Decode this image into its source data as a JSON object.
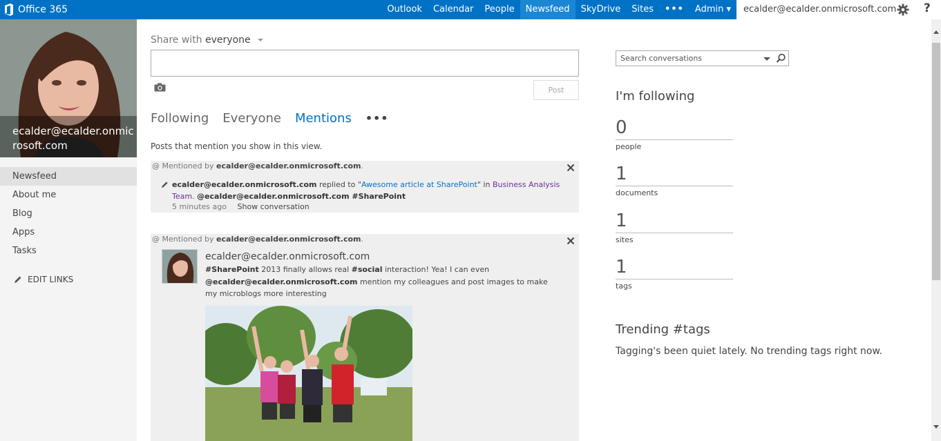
{
  "topbar": {
    "brand": "Office 365",
    "nav": [
      {
        "label": "Outlook"
      },
      {
        "label": "Calendar"
      },
      {
        "label": "People"
      },
      {
        "label": "Newsfeed",
        "active": true
      },
      {
        "label": "SkyDrive"
      },
      {
        "label": "Sites"
      },
      {
        "label": "•••"
      },
      {
        "label": "Admin ▾"
      }
    ],
    "user": "ecalder@ecalder.onmicrosoft.com ▾",
    "help": "?"
  },
  "profile": {
    "name": "ecalder@ecalder.onmicrosoft.com"
  },
  "quicklaunch": {
    "items": [
      "Newsfeed",
      "About me",
      "Blog",
      "Apps",
      "Tasks"
    ],
    "edit_links": "EDIT LINKS"
  },
  "composer": {
    "share_prefix": "Share with",
    "share_target": "everyone",
    "post_button": "Post"
  },
  "tabs": {
    "following": "Following",
    "everyone": "Everyone",
    "mentions": "Mentions",
    "more": "•••"
  },
  "hint": "Posts that mention you show in this view.",
  "feed": {
    "post1": {
      "mentioned_prefix": "Mentioned by",
      "mentioned_by": "ecalder@ecalder.onmicrosoft.com",
      "actor": "ecalder@ecalder.onmicrosoft.com",
      "replied_to": "replied to \"",
      "link": "Awesome article at SharePoint",
      "in": "\" in",
      "team": "Business Analysis Team",
      "mention": "@ecalder@ecalder.onmicrosoft.com #SharePoint",
      "time": "5 minutes ago",
      "show": "Show conversation"
    },
    "post2": {
      "mentioned_prefix": "Mentioned by",
      "mentioned_by": "ecalder@ecalder.onmicrosoft.com",
      "author": "ecalder@ecalder.onmicrosoft.com",
      "tag1": "#SharePoint",
      "text1": "2013 finally allows real",
      "tag2": "#social",
      "text2": "interaction! Yea! I can even",
      "mention": "@ecalder@ecalder.onmicrosoft.com",
      "text3": "mention my colleagues and post images to make my microblogs more interesting"
    }
  },
  "right": {
    "search_placeholder": "Search conversations",
    "following_title": "I'm following",
    "stats": [
      {
        "value": "0",
        "label": "people"
      },
      {
        "value": "1",
        "label": "documents"
      },
      {
        "value": "1",
        "label": "sites"
      },
      {
        "value": "1",
        "label": "tags"
      }
    ],
    "trending_title": "Trending #tags",
    "trending_text": "Tagging's been quiet lately. No trending tags right now."
  },
  "colors": {
    "brand": "#0072c6",
    "team_link": "#6a2f9a"
  }
}
